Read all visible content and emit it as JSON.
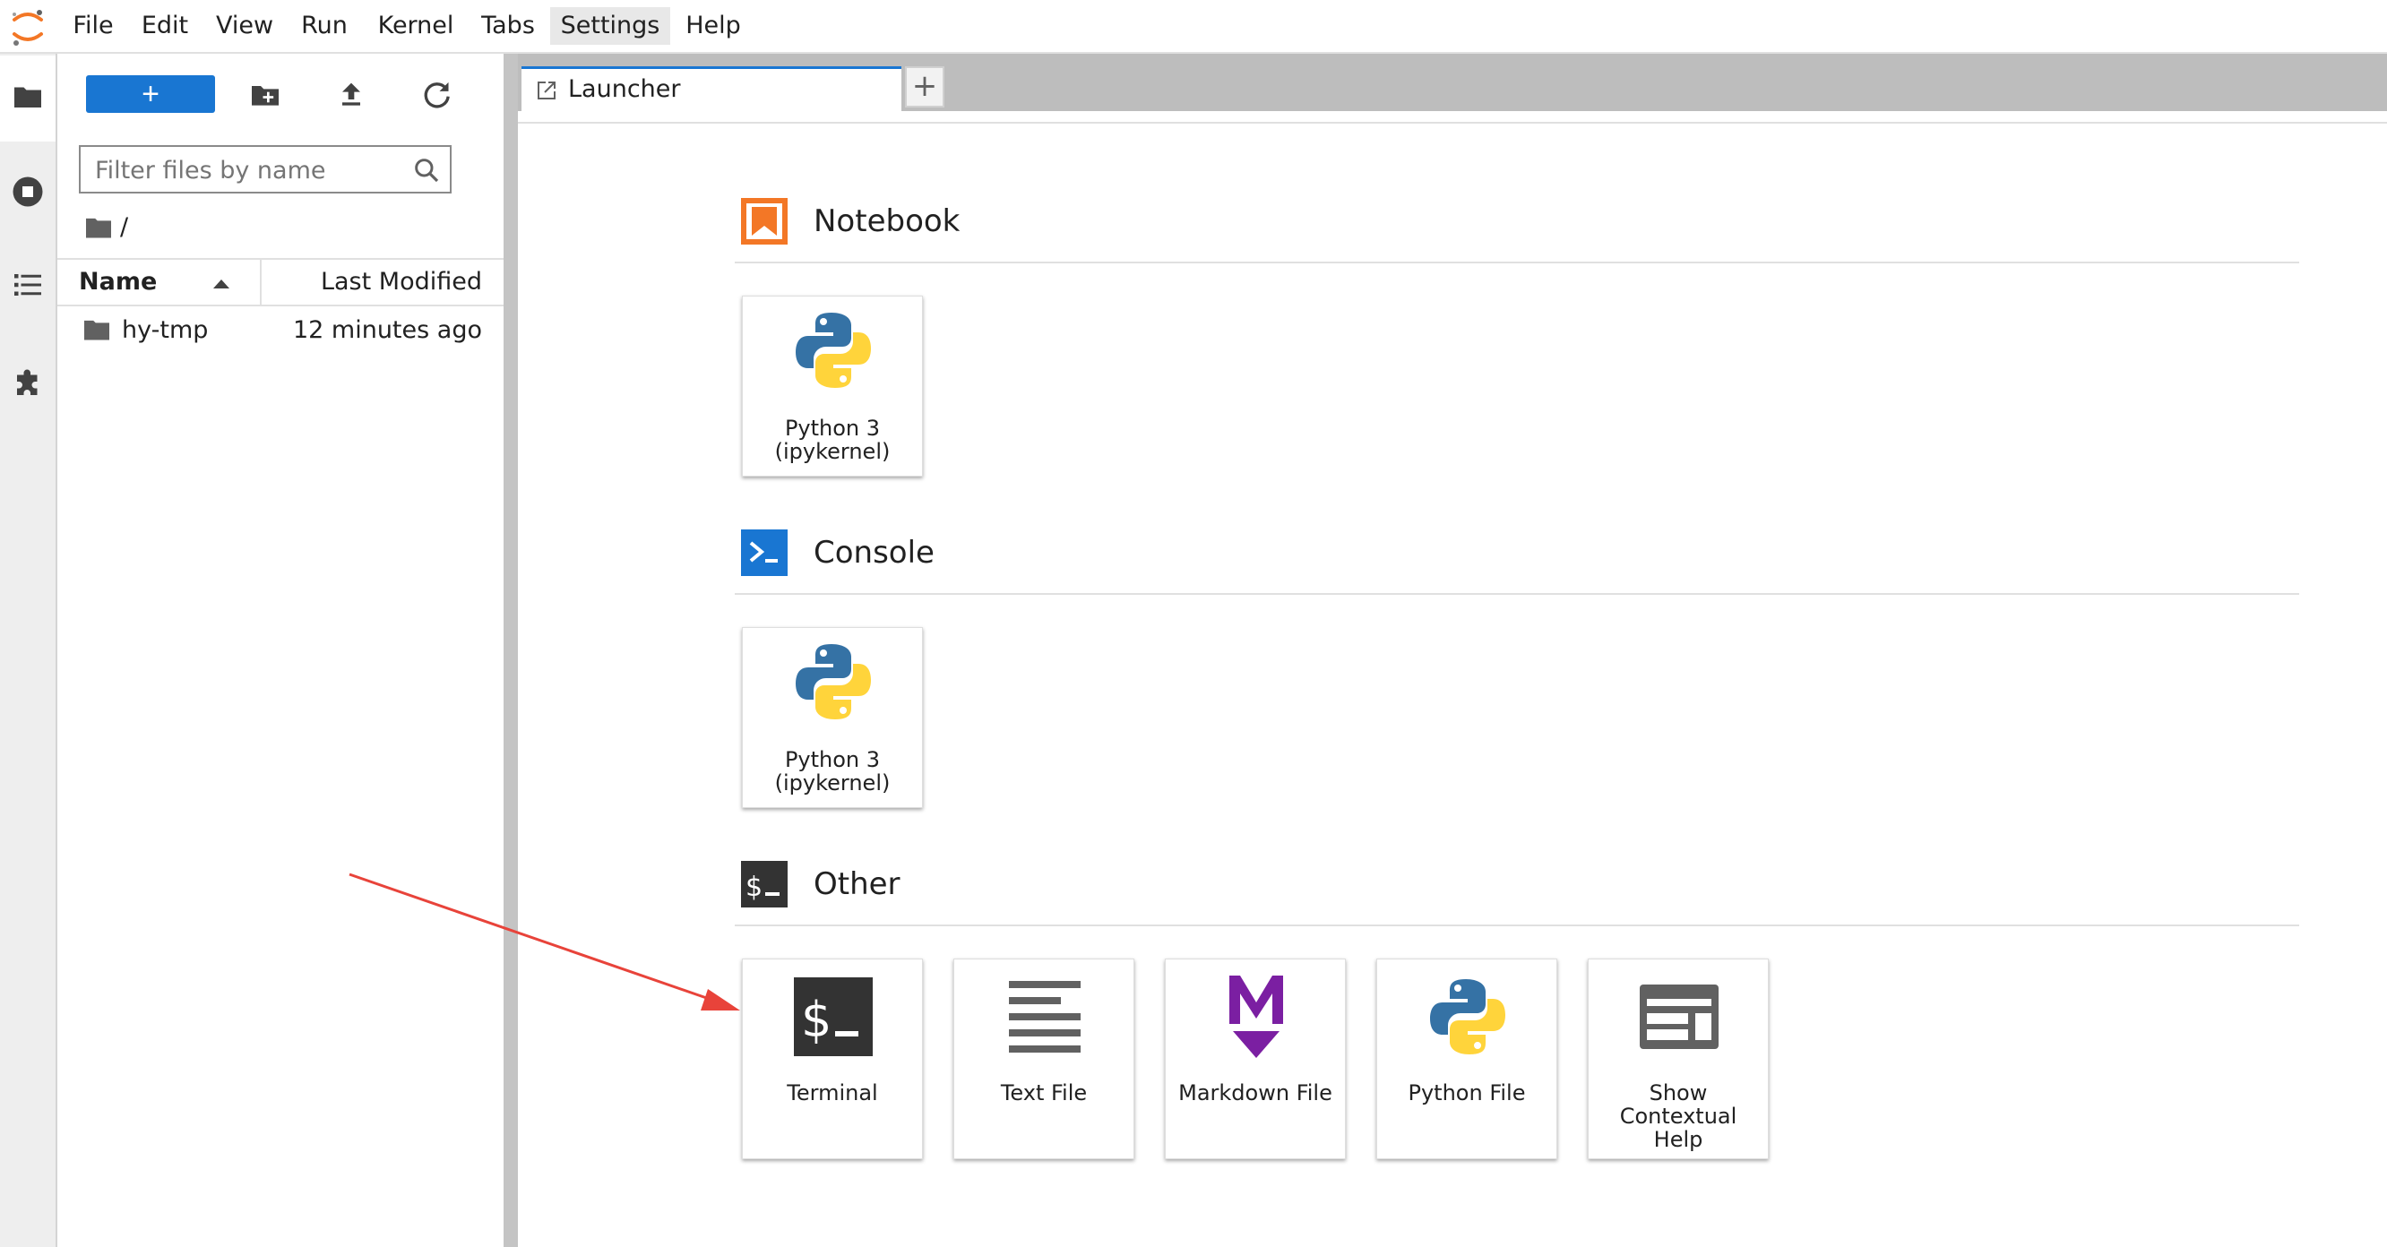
{
  "menubar": {
    "items": [
      "File",
      "Edit",
      "View",
      "Run",
      "Kernel",
      "Tabs",
      "Settings",
      "Help"
    ],
    "active": "Settings"
  },
  "activity_bar": {
    "icons": [
      "folder-icon",
      "running-stop-icon",
      "table-of-contents-icon",
      "extension-puzzle-icon"
    ]
  },
  "file_browser": {
    "new_button_label": "+",
    "filter_placeholder": "Filter files by name",
    "breadcrumb": "/",
    "columns": {
      "name": "Name",
      "last_modified": "Last Modified"
    },
    "rows": [
      {
        "name": "hy-tmp",
        "modified": "12 minutes ago",
        "icon": "folder-icon"
      }
    ]
  },
  "tabs": {
    "items": [
      {
        "label": "Launcher",
        "icon": "launcher-icon"
      }
    ],
    "add_label": "+"
  },
  "launcher": {
    "sections": [
      {
        "title": "Notebook",
        "icon": "notebook-icon",
        "cards": [
          {
            "label": "Python 3\n(ipykernel)",
            "icon": "python-icon"
          }
        ]
      },
      {
        "title": "Console",
        "icon": "console-icon",
        "cards": [
          {
            "label": "Python 3\n(ipykernel)",
            "icon": "python-icon"
          }
        ]
      },
      {
        "title": "Other",
        "icon": "terminal-section-icon",
        "cards": [
          {
            "label": "Terminal",
            "icon": "terminal-icon"
          },
          {
            "label": "Text File",
            "icon": "text-file-icon"
          },
          {
            "label": "Markdown File",
            "icon": "markdown-icon"
          },
          {
            "label": "Python File",
            "icon": "python-icon"
          },
          {
            "label": "Show\nContextual\nHelp",
            "icon": "contextual-help-icon"
          }
        ]
      }
    ]
  },
  "colors": {
    "accent": "#1976d2",
    "notebook_orange": "#f37726",
    "markdown_purple": "#7b1fa2",
    "annotation_arrow": "#e8433a"
  }
}
